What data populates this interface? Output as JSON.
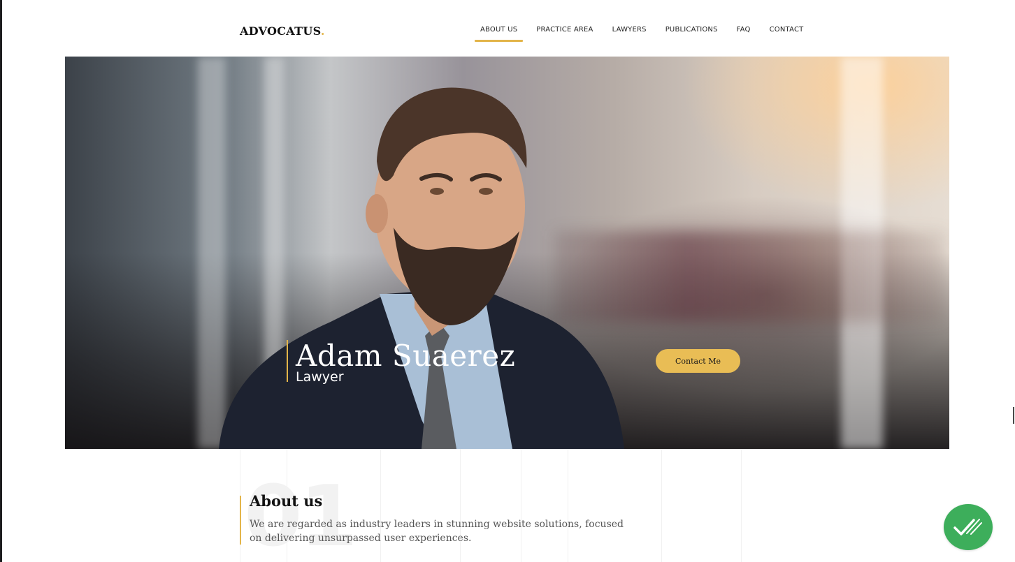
{
  "brand": {
    "name": "ADVOCATUS",
    "dot": ".",
    "accent_color": "#e3b54a"
  },
  "nav": {
    "items": [
      {
        "label": "ABOUT US",
        "active": true
      },
      {
        "label": "PRACTICE AREA",
        "active": false
      },
      {
        "label": "LAWYERS",
        "active": false
      },
      {
        "label": "PUBLICATIONS",
        "active": false
      },
      {
        "label": "FAQ",
        "active": false
      },
      {
        "label": "CONTACT",
        "active": false
      }
    ]
  },
  "hero": {
    "name": "Adam Suaerez",
    "role": "Lawyer",
    "cta_label": "Contact Me",
    "cta_color": "#e9bd55"
  },
  "about": {
    "number": "01",
    "title": "About us",
    "text": "We are regarded as industry leaders in stunning website solutions, focused on delivering unsurpassed user experiences."
  },
  "badge": {
    "icon": "double-check-icon",
    "color": "#3dae5b"
  }
}
